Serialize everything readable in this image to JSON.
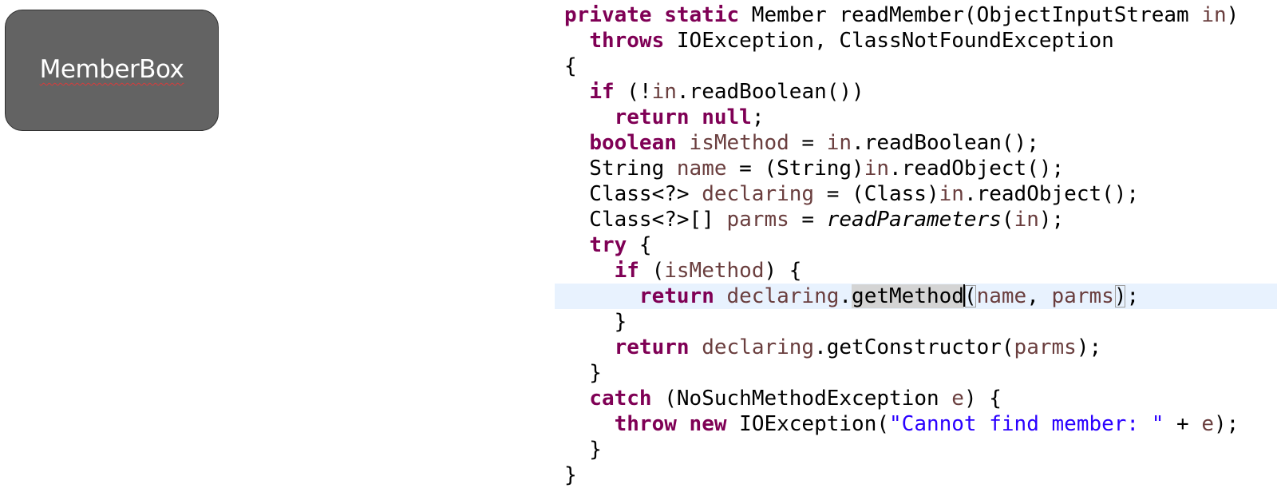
{
  "slide": {
    "member_box_label": "MemberBox"
  },
  "code": {
    "language": "java",
    "colors": {
      "keyword": "#7f0055",
      "variable": "#6a3e3e",
      "string": "#2a00ff",
      "current_line": "#e8f2fe",
      "occurrence": "#d4d4d4"
    },
    "current_line_index": 11,
    "caret_after": "getMethod",
    "lines": [
      [
        {
          "t": "private static",
          "c": "kw"
        },
        {
          "t": " Member readMember(ObjectInputStream "
        },
        {
          "t": "in",
          "c": "var"
        },
        {
          "t": ")"
        }
      ],
      [
        {
          "t": "  "
        },
        {
          "t": "throws",
          "c": "kw"
        },
        {
          "t": " IOException, ClassNotFoundException"
        }
      ],
      [
        {
          "t": "{"
        }
      ],
      [
        {
          "t": "  "
        },
        {
          "t": "if",
          "c": "kw"
        },
        {
          "t": " (!"
        },
        {
          "t": "in",
          "c": "var"
        },
        {
          "t": ".readBoolean())"
        }
      ],
      [
        {
          "t": "    "
        },
        {
          "t": "return null",
          "c": "kw"
        },
        {
          "t": ";"
        }
      ],
      [
        {
          "t": "  "
        },
        {
          "t": "boolean",
          "c": "kw"
        },
        {
          "t": " "
        },
        {
          "t": "isMethod",
          "c": "var"
        },
        {
          "t": " = "
        },
        {
          "t": "in",
          "c": "var"
        },
        {
          "t": ".readBoolean();"
        }
      ],
      [
        {
          "t": "  String "
        },
        {
          "t": "name",
          "c": "var"
        },
        {
          "t": " = (String)"
        },
        {
          "t": "in",
          "c": "var"
        },
        {
          "t": ".readObject();"
        }
      ],
      [
        {
          "t": "  Class<?> "
        },
        {
          "t": "declaring",
          "c": "var"
        },
        {
          "t": " = (Class)"
        },
        {
          "t": "in",
          "c": "var"
        },
        {
          "t": ".readObject();"
        }
      ],
      [
        {
          "t": "  Class<?>[] "
        },
        {
          "t": "parms",
          "c": "var"
        },
        {
          "t": " = "
        },
        {
          "t": "readParameters",
          "c": "ital"
        },
        {
          "t": "("
        },
        {
          "t": "in",
          "c": "var"
        },
        {
          "t": ");"
        }
      ],
      [
        {
          "t": "  "
        },
        {
          "t": "try",
          "c": "kw"
        },
        {
          "t": " {"
        }
      ],
      [
        {
          "t": "    "
        },
        {
          "t": "if",
          "c": "kw"
        },
        {
          "t": " ("
        },
        {
          "t": "isMethod",
          "c": "var"
        },
        {
          "t": ") {"
        }
      ],
      [
        {
          "t": "      "
        },
        {
          "t": "return",
          "c": "kw"
        },
        {
          "t": " "
        },
        {
          "t": "declaring",
          "c": "var"
        },
        {
          "t": "."
        },
        {
          "t": "getMethod",
          "c": "occur"
        },
        {
          "t": "",
          "c": "caret"
        },
        {
          "t": "(",
          "c": "match"
        },
        {
          "t": "name",
          "c": "var"
        },
        {
          "t": ", "
        },
        {
          "t": "parms",
          "c": "var"
        },
        {
          "t": ")",
          "c": "match"
        },
        {
          "t": ";"
        }
      ],
      [
        {
          "t": "    }"
        }
      ],
      [
        {
          "t": "    "
        },
        {
          "t": "return",
          "c": "kw"
        },
        {
          "t": " "
        },
        {
          "t": "declaring",
          "c": "var"
        },
        {
          "t": ".getConstructor("
        },
        {
          "t": "parms",
          "c": "var"
        },
        {
          "t": ");"
        }
      ],
      [
        {
          "t": "  }"
        }
      ],
      [
        {
          "t": "  "
        },
        {
          "t": "catch",
          "c": "kw"
        },
        {
          "t": " (NoSuchMethodException "
        },
        {
          "t": "e",
          "c": "var"
        },
        {
          "t": ") {"
        }
      ],
      [
        {
          "t": "    "
        },
        {
          "t": "throw new",
          "c": "kw"
        },
        {
          "t": " IOException("
        },
        {
          "t": "\"Cannot find member: \"",
          "c": "str"
        },
        {
          "t": " + "
        },
        {
          "t": "e",
          "c": "var"
        },
        {
          "t": ");"
        }
      ],
      [
        {
          "t": "  }"
        }
      ],
      [
        {
          "t": "}"
        }
      ]
    ]
  }
}
